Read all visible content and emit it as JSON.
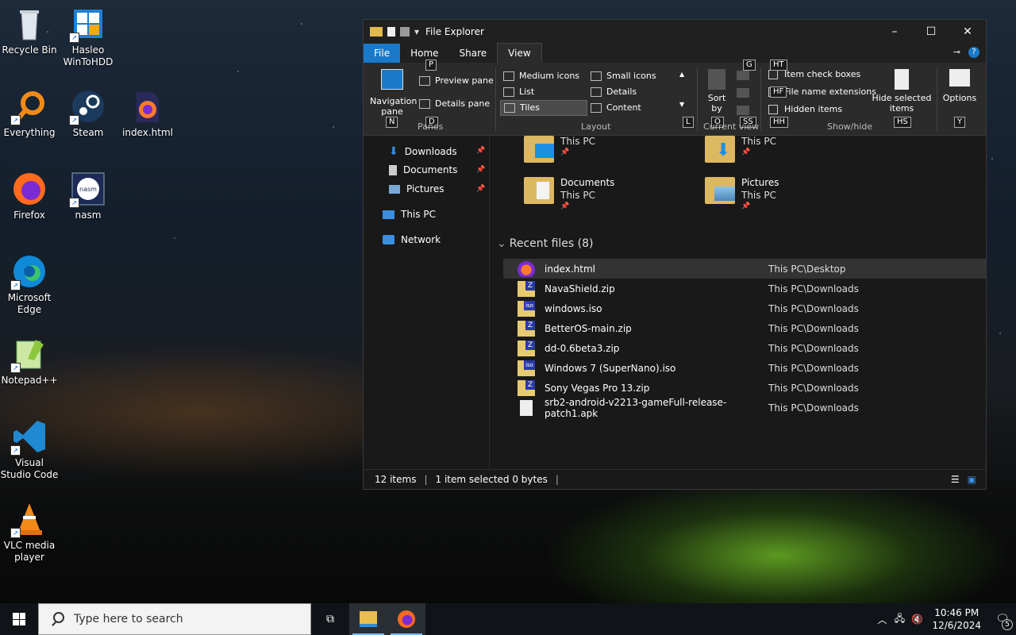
{
  "desktop": {
    "icons": [
      {
        "label": "Recycle Bin"
      },
      {
        "label": "Hasleo WinToHDD"
      },
      {
        "label": "Everything"
      },
      {
        "label": "Steam"
      },
      {
        "label": "index.html"
      },
      {
        "label": "Firefox"
      },
      {
        "label": "nasm"
      },
      {
        "label": "Microsoft Edge"
      },
      {
        "label": "Notepad++"
      },
      {
        "label": "Visual Studio Code"
      },
      {
        "label": "VLC media player"
      }
    ]
  },
  "explorer": {
    "title": "File Explorer",
    "tabs": {
      "file": "File",
      "home": "Home",
      "share": "Share",
      "view": "View"
    },
    "ribbon": {
      "nav_pane": "Navigation pane",
      "preview_pane": "Preview pane",
      "details_pane": "Details pane",
      "panes_label": "Panes",
      "layout": {
        "medium_icons": "Medium icons",
        "small_icons": "Small icons",
        "list": "List",
        "details": "Details",
        "tiles": "Tiles",
        "content": "Content",
        "label": "Layout"
      },
      "sort_by": "Sort by",
      "current_view_label": "Current view",
      "item_check_boxes": "Item check boxes",
      "file_name_extensions": "File name extensions",
      "hidden_items": "Hidden items",
      "hide_selected_items": "Hide selected items",
      "show_hide_label": "Show/hide",
      "options": "Options",
      "keytips": {
        "p": "P",
        "n": "N",
        "d": "D",
        "l": "L",
        "g": "G",
        "o": "O",
        "ss": "SS",
        "ht": "HT",
        "hf": "HF",
        "hh": "HH",
        "hs": "HS",
        "y": "Y"
      }
    },
    "nav_items": {
      "downloads": "Downloads",
      "documents": "Documents",
      "pictures": "Pictures",
      "this_pc": "This PC",
      "network": "Network"
    },
    "quick_access_tiles": [
      {
        "name": "",
        "location": "This PC"
      },
      {
        "name": "",
        "location": "This PC"
      },
      {
        "name": "Documents",
        "location": "This PC"
      },
      {
        "name": "Pictures",
        "location": "This PC"
      }
    ],
    "recent_header": "Recent files (8)",
    "recent_files": [
      {
        "name": "index.html",
        "path": "This PC\\Desktop",
        "type": "html"
      },
      {
        "name": "NavaShield.zip",
        "path": "This PC\\Downloads",
        "type": "zip"
      },
      {
        "name": "windows.iso",
        "path": "This PC\\Downloads",
        "type": "iso"
      },
      {
        "name": "BetterOS-main.zip",
        "path": "This PC\\Downloads",
        "type": "zip"
      },
      {
        "name": "dd-0.6beta3.zip",
        "path": "This PC\\Downloads",
        "type": "zip"
      },
      {
        "name": "Windows 7 (SuperNano).iso",
        "path": "This PC\\Downloads",
        "type": "iso"
      },
      {
        "name": "Sony Vegas Pro 13.zip",
        "path": "This PC\\Downloads",
        "type": "zip"
      },
      {
        "name": "srb2-android-v2213-gameFull-release-patch1.apk",
        "path": "This PC\\Downloads",
        "type": "apk"
      }
    ],
    "status": {
      "items": "12 items",
      "selected": "1 item selected  0 bytes"
    }
  },
  "taskbar": {
    "search_placeholder": "Type here to search",
    "time": "10:46 PM",
    "date": "12/6/2024",
    "notification_count": "5"
  },
  "colors": {
    "accent": "#1979ca",
    "window_bg": "#191919",
    "taskbar_bg": "#101418"
  }
}
